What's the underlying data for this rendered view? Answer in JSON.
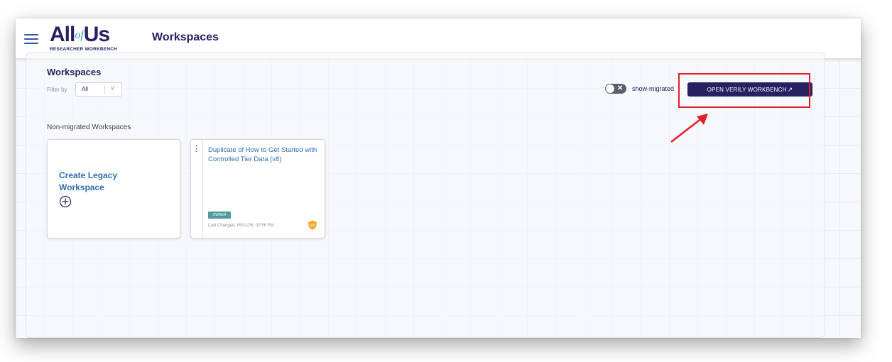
{
  "header": {
    "logo_main": "All",
    "logo_of": "of",
    "logo_us": "Us",
    "logo_sub": "RESEARCHER WORKBENCH",
    "title": "Workspaces"
  },
  "panel": {
    "title": "Workspaces",
    "filter_label": "Filter by",
    "filter_value": "All",
    "toggle_label": "show-migrated",
    "verily_button": "OPEN VERILY WORKBENCH"
  },
  "section": {
    "label": "Non-migrated Workspaces"
  },
  "create_card": {
    "label": "Create Legacy Workspace"
  },
  "workspace_card": {
    "title": "Duplicate of How to Get Started with Controlled Tier Data (v8)",
    "badge": "OWNER",
    "last_changed": "Last Changed: 05/11/26, 02:56 PM",
    "tier": "CT"
  },
  "colors": {
    "brand_navy": "#262262",
    "link_blue": "#2e6fb2",
    "owner_teal": "#4f9b9b",
    "ct_orange": "#f5a623",
    "annotation_red": "#e0202a"
  },
  "icons": {
    "menu": "hamburger-icon",
    "dropdown": "chevron-down-icon",
    "external": "external-link-icon",
    "add": "plus-circle-icon",
    "more": "kebab-menu-icon",
    "tier": "ct-shield-icon"
  }
}
